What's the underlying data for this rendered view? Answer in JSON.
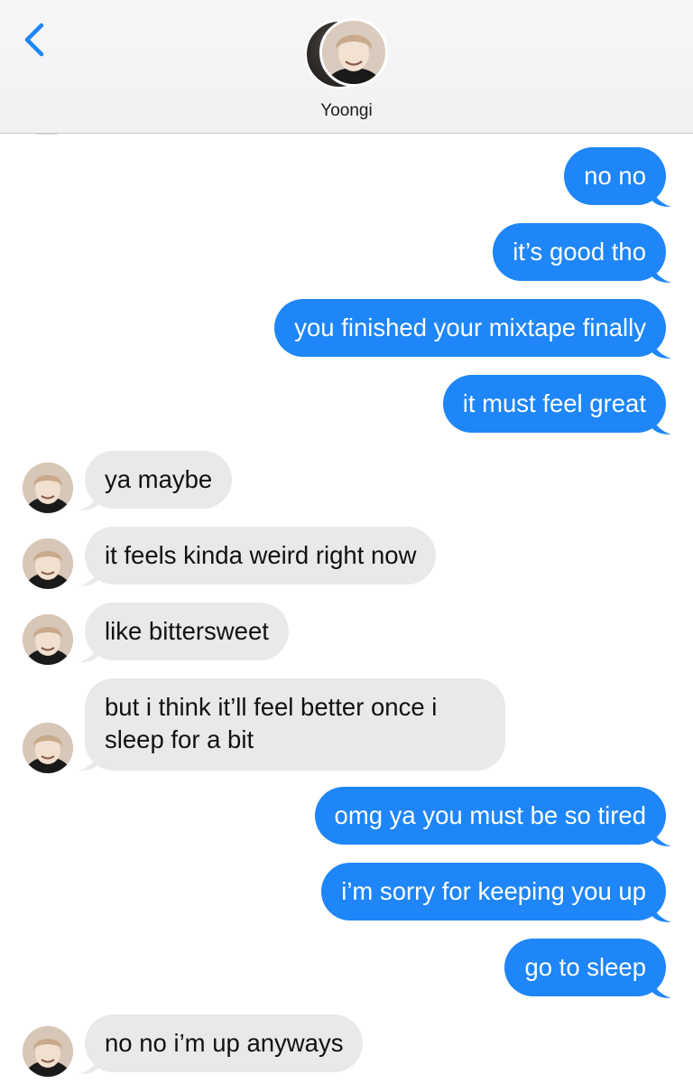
{
  "header": {
    "back_icon": "chevron-left-icon",
    "contact_name": "Yoongi",
    "accent_color": "#1e86f8"
  },
  "messages": [
    {
      "direction": "out",
      "text": "no no"
    },
    {
      "direction": "out",
      "text": "it’s good tho"
    },
    {
      "direction": "out",
      "text": "you finished your mixtape finally"
    },
    {
      "direction": "out",
      "text": "it must feel great"
    },
    {
      "direction": "in",
      "text": "ya maybe"
    },
    {
      "direction": "in",
      "text": "it feels kinda weird right now"
    },
    {
      "direction": "in",
      "text": "like bittersweet"
    },
    {
      "direction": "in",
      "text": "but i think it’ll feel better once i sleep for a bit"
    },
    {
      "direction": "out",
      "text": "omg ya you must be so tired"
    },
    {
      "direction": "out",
      "text": "i’m sorry for keeping you up"
    },
    {
      "direction": "out",
      "text": "go to sleep"
    },
    {
      "direction": "in",
      "text": "no no i’m up anyways"
    }
  ],
  "colors": {
    "outgoing_bubble": "#1e86f8",
    "incoming_bubble": "#e9e9eb"
  }
}
